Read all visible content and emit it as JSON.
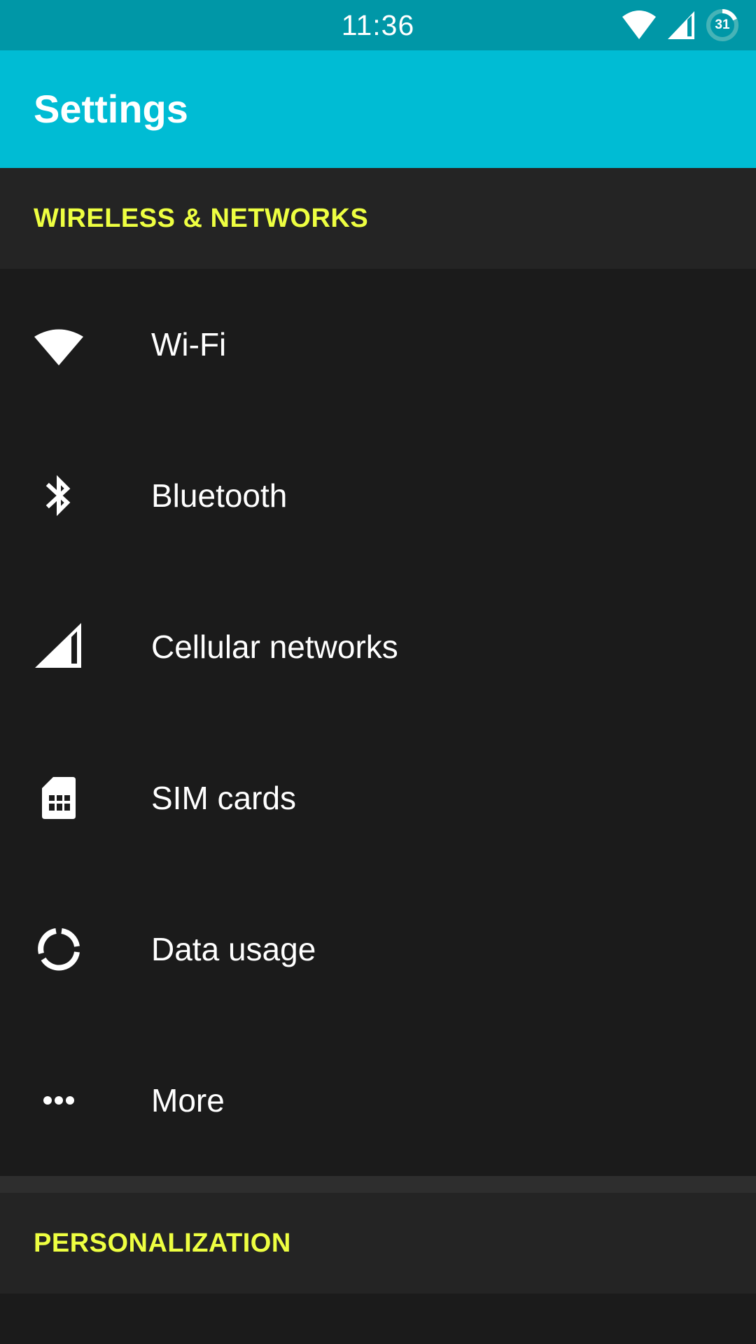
{
  "status_bar": {
    "time": "11:36",
    "battery_level": "31",
    "icons": [
      "wifi-icon",
      "cellular-signal-icon",
      "battery-icon"
    ]
  },
  "app_bar": {
    "title": "Settings"
  },
  "sections": [
    {
      "title": "WIRELESS & NETWORKS",
      "items": [
        {
          "label": "Wi-Fi",
          "icon": "wifi-icon"
        },
        {
          "label": "Bluetooth",
          "icon": "bluetooth-icon"
        },
        {
          "label": "Cellular networks",
          "icon": "cellular-signal-icon"
        },
        {
          "label": "SIM cards",
          "icon": "sim-card-icon"
        },
        {
          "label": "Data usage",
          "icon": "data-usage-icon"
        },
        {
          "label": "More",
          "icon": "more-dots-icon"
        }
      ]
    },
    {
      "title": "PERSONALIZATION",
      "items": []
    }
  ],
  "colors": {
    "status_bar": "#0097a7",
    "app_bar": "#00bcd4",
    "section_title": "#eeff41",
    "section_header_bg": "#242424",
    "list_bg": "#1b1b1b",
    "text": "#ffffff"
  }
}
